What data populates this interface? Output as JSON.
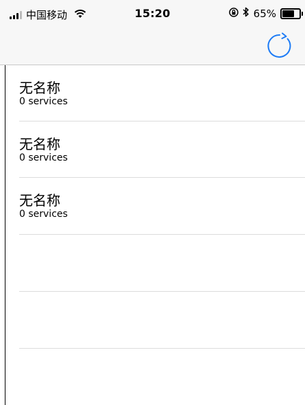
{
  "status_bar": {
    "carrier": "中国移动",
    "time": "15:20",
    "battery_percent": "65%",
    "battery_level": 0.65,
    "icons": [
      "signal-icon",
      "wifi-icon",
      "orientation-lock-icon",
      "bluetooth-icon",
      "battery-icon"
    ]
  },
  "nav": {
    "right_icon": "refresh-icon"
  },
  "list": {
    "items": [
      {
        "title": "无名称",
        "subtitle": "0 services"
      },
      {
        "title": "无名称",
        "subtitle": "0 services"
      },
      {
        "title": "无名称",
        "subtitle": "0 services"
      }
    ],
    "empty_rows": 2
  },
  "colors": {
    "accent": "#1e7cf6",
    "bar_background": "#f7f7f7",
    "separator": "#dcdcdc"
  }
}
